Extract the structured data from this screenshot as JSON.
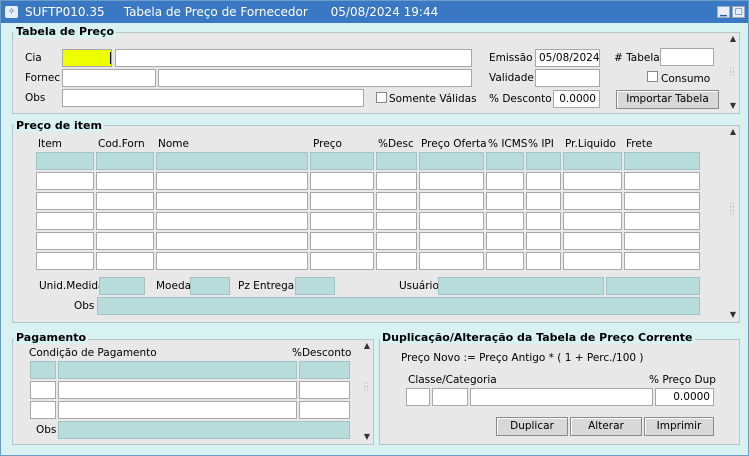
{
  "window": {
    "title": "SUFTP010.35     Tabela de Preço de Fornecedor      05/08/2024 19:44",
    "minimize": "▁",
    "maximize": "▢"
  },
  "tabela": {
    "legend": "Tabela de Preço",
    "cia_label": "Cia",
    "cia_value": "",
    "fornec_label": "Fornec",
    "obs_label": "Obs",
    "somente_validas_label": "Somente Válidas",
    "emissao_label": "Emissão",
    "emissao_value": "05/08/2024",
    "validade_label": "Validade",
    "desconto_label": "% Desconto",
    "desconto_value": "0.0000",
    "num_tabela_label": "# Tabela",
    "consumo_label": "Consumo",
    "importar_button": "Importar Tabela"
  },
  "item": {
    "legend": "Preço de item",
    "headers": [
      "Item",
      "Cod.Forn",
      "Nome",
      "Preço",
      "%Desc",
      "Preço Oferta",
      "% ICMS",
      "% IPI",
      "Pr.Liquido",
      "Frete"
    ],
    "unid_medida_label": "Unid.Medida",
    "moeda_label": "Moeda",
    "pz_entrega_label": "Pz Entrega",
    "usuario_label": "Usuário",
    "obs_label": "Obs"
  },
  "pagamento": {
    "legend": "Pagamento",
    "condicao_label": "Condição de Pagamento",
    "desconto_label": "%Desconto",
    "obs_label": "Obs"
  },
  "duplicacao": {
    "legend": "Duplicação/Alteração da Tabela de Preço Corrente",
    "formula": "Preço Novo := Preço Antigo * ( 1 + Perc./100 )",
    "classe_label": "Classe/Categoria",
    "preco_dup_label": "% Preço Dup",
    "preco_dup_value": "0.0000",
    "duplicar_button": "Duplicar",
    "alterar_button": "Alterar",
    "imprimir_button": "Imprimir"
  },
  "colors": {
    "title_bar": "#3b78c4",
    "readonly_field": "#b8dcdc",
    "focus_field": "#eeff00",
    "background": "#d8f2f2"
  }
}
